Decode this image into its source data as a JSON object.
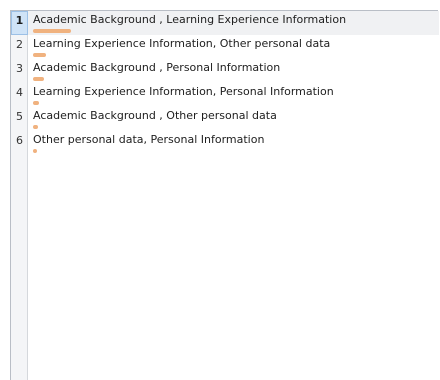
{
  "colors": {
    "bar": "#f0b27f",
    "selected_number_bg": "#cfe3f7"
  },
  "rows": [
    {
      "number": "1",
      "label": "Academic Background , Learning Experience Information",
      "score": 1.0
    },
    {
      "number": "2",
      "label": "Learning Experience Information, Other personal data",
      "score": 0.35
    },
    {
      "number": "3",
      "label": "Academic Background , Personal Information",
      "score": 0.3
    },
    {
      "number": "4",
      "label": "Learning Experience Information, Personal Information",
      "score": 0.15
    },
    {
      "number": "5",
      "label": "Academic Background , Other personal data",
      "score": 0.12
    },
    {
      "number": "6",
      "label": "Other personal data, Personal Information",
      "score": 0.1
    }
  ],
  "selected_index": 0
}
